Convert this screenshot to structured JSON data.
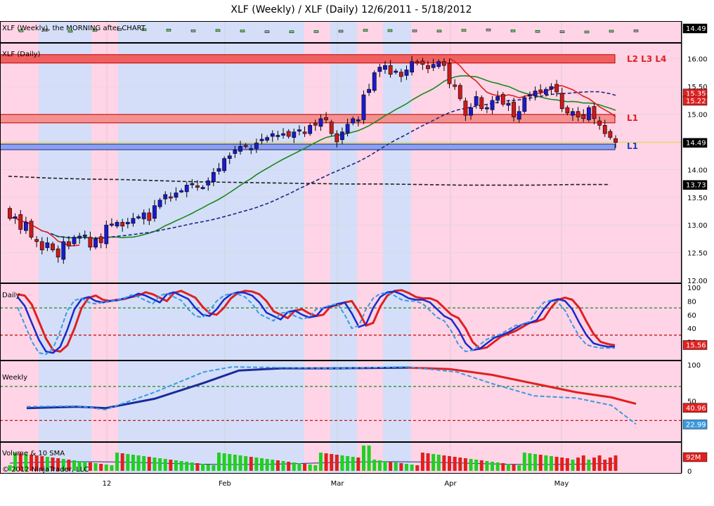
{
  "title": "XLF (Weekly) / XLF (Daily)  12/6/2011 - 5/18/2012",
  "panels": {
    "weekly_strip": {
      "label": "XLF (Weekly), the MORNING after CHART",
      "last": "14.49"
    },
    "price": {
      "label": "XLF (Daily)",
      "y_ticks": [
        "16.00",
        "15.50",
        "15.00",
        "14.50",
        "14.00",
        "13.50",
        "13.00",
        "12.50",
        "12.00"
      ],
      "zones": [
        {
          "label": "L2 L3 L4",
          "color": "#e02020"
        },
        {
          "label": "L1",
          "color": "#e02020"
        },
        {
          "label": "L1",
          "color": "#2040c0"
        }
      ],
      "flags": [
        {
          "text": "15.35",
          "color": "#e02020"
        },
        {
          "text": "15.22",
          "color": "#e02020"
        },
        {
          "text": "14.49",
          "color": "#000000"
        },
        {
          "text": "13.73",
          "color": "#000000"
        }
      ]
    },
    "daily_stoch": {
      "label": "Daily",
      "y_ticks": [
        "100",
        "80",
        "60",
        "40",
        "20"
      ],
      "flag": "15.56"
    },
    "weekly_stoch": {
      "label": "Weekly",
      "y_ticks": [
        "100",
        "50"
      ],
      "flags": [
        "40.96",
        "22.99"
      ]
    },
    "volume": {
      "label": "Volume & 10 SMA",
      "y_ticks": [
        "0"
      ],
      "flag": "92M"
    }
  },
  "x_ticks": [
    "12",
    "Feb",
    "Mar",
    "Apr",
    "May"
  ],
  "copyright": "© 2012 NinjaTrader, LLC",
  "colors": {
    "up": "#1a1acc",
    "down": "#cc1a1a",
    "pink": "#ffd4e6",
    "blue": "#d4def8",
    "sma_green": "#1a8a1a"
  },
  "chart_data": {
    "type": "candlestick",
    "price_series": {
      "name": "XLF (Daily)",
      "dates": [
        "12/6",
        "12/7",
        "12/8",
        "12/9",
        "12/12",
        "12/13",
        "12/14",
        "12/15",
        "12/16",
        "12/19",
        "12/20",
        "12/21",
        "12/22",
        "12/23",
        "12/27",
        "12/28",
        "12/29",
        "12/30",
        "1/3",
        "1/4",
        "1/5",
        "1/6",
        "1/9",
        "1/10",
        "1/11",
        "1/12",
        "1/13",
        "1/17",
        "1/18",
        "1/19",
        "1/20",
        "1/23",
        "1/24",
        "1/25",
        "1/26",
        "1/27",
        "1/30",
        "1/31",
        "2/1",
        "2/2",
        "2/3",
        "2/6",
        "2/7",
        "2/8",
        "2/9",
        "2/10",
        "2/13",
        "2/14",
        "2/15",
        "2/16",
        "2/17",
        "2/21",
        "2/22",
        "2/23",
        "2/24",
        "2/27",
        "2/28",
        "2/29",
        "3/1",
        "3/2",
        "3/5",
        "3/6",
        "3/7",
        "3/8",
        "3/9",
        "3/12",
        "3/13",
        "3/14",
        "3/15",
        "3/16",
        "3/19",
        "3/20",
        "3/21",
        "3/22",
        "3/23",
        "3/26",
        "3/27",
        "3/28",
        "3/29",
        "3/30",
        "4/2",
        "4/3",
        "4/4",
        "4/5",
        "4/9",
        "4/10",
        "4/11",
        "4/12",
        "4/13",
        "4/16",
        "4/17",
        "4/18",
        "4/19",
        "4/20",
        "4/23",
        "4/24",
        "4/25",
        "4/26",
        "4/27",
        "4/30",
        "5/1",
        "5/2",
        "5/3",
        "5/4",
        "5/7",
        "5/8",
        "5/9",
        "5/10",
        "5/11",
        "5/14",
        "5/15",
        "5/16",
        "5/17",
        "5/18"
      ],
      "close": [
        13.12,
        13.15,
        12.92,
        13.05,
        12.78,
        12.7,
        12.55,
        12.68,
        12.55,
        12.42,
        12.7,
        12.62,
        12.78,
        12.8,
        12.82,
        12.6,
        12.75,
        12.68,
        13.0,
        13.02,
        13.05,
        12.98,
        13.05,
        13.12,
        13.15,
        13.22,
        13.08,
        13.35,
        13.45,
        13.55,
        13.5,
        13.58,
        13.62,
        13.72,
        13.75,
        13.68,
        13.68,
        13.8,
        13.95,
        14.02,
        14.2,
        14.25,
        14.35,
        14.42,
        14.42,
        14.38,
        14.48,
        14.55,
        14.58,
        14.65,
        14.62,
        14.65,
        14.6,
        14.68,
        14.72,
        14.65,
        14.8,
        14.8,
        14.92,
        14.9,
        14.65,
        14.5,
        14.68,
        14.82,
        14.92,
        14.9,
        15.35,
        15.45,
        15.75,
        15.85,
        15.88,
        15.72,
        15.78,
        15.68,
        15.8,
        15.95,
        15.92,
        15.9,
        15.82,
        15.9,
        15.95,
        15.88,
        15.55,
        15.5,
        15.28,
        14.98,
        15.12,
        15.32,
        15.1,
        15.12,
        15.25,
        15.32,
        15.18,
        15.2,
        14.95,
        15.05,
        15.3,
        15.35,
        15.42,
        15.4,
        15.45,
        15.5,
        15.4,
        15.1,
        15.02,
        15.05,
        14.95,
        14.92,
        15.12,
        14.92,
        14.8,
        14.65,
        14.58,
        14.49
      ],
      "ylim": [
        12.0,
        16.25
      ]
    },
    "overlays": [
      {
        "name": "20 SMA (green)",
        "color": "#1a8a1a"
      },
      {
        "name": "50 SMA (dashed navy)",
        "color": "#1a2a80"
      },
      {
        "name": "Weekly MA (dashed black)",
        "value": 13.73
      }
    ],
    "levels": [
      {
        "name": "L2 L3 L4",
        "value": 16.0
      },
      {
        "name": "L1",
        "value": 14.92
      },
      {
        "name": "L1",
        "value": 14.41
      }
    ],
    "daily_stochastic": {
      "ylim": [
        0,
        100
      ],
      "last": 15.56,
      "lines": [
        70,
        30
      ]
    },
    "weekly_stochastic": {
      "ylim": [
        0,
        100
      ],
      "lasts": [
        40.96,
        22.99
      ]
    },
    "volume": {
      "last": "92M"
    }
  }
}
